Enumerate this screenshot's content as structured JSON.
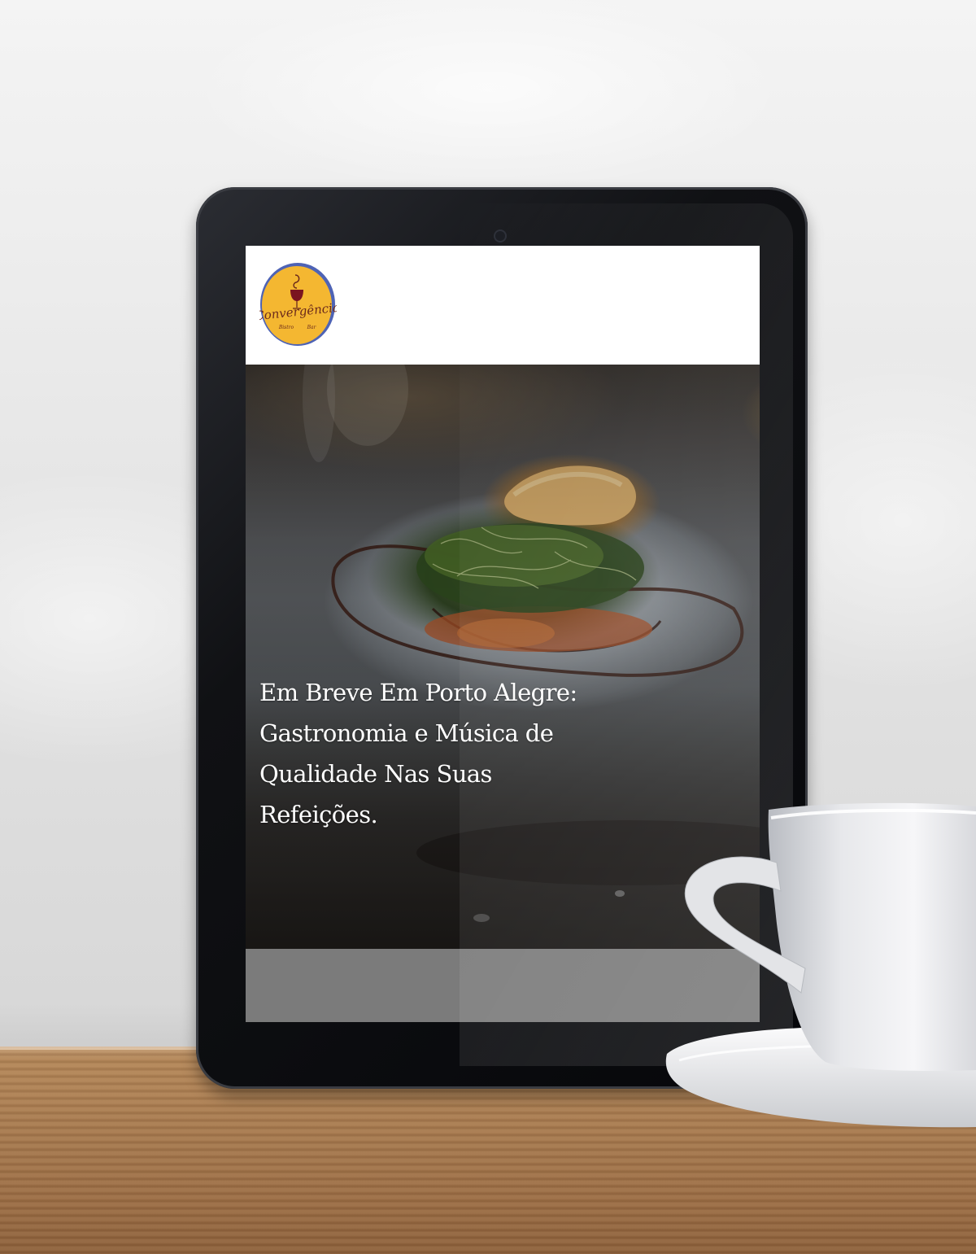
{
  "site": {
    "logo": {
      "brand_text": "Convergência",
      "subtitle_left": "Bistro",
      "subtitle_right": "Bar",
      "colors": {
        "fill": "#f4b731",
        "ring": "#4e63b5",
        "text": "#6b2a1c"
      }
    }
  },
  "hero": {
    "title": "Em Breve Em Porto Alegre: Gastronomia e Música de Qualidade Nas Suas Refeições."
  },
  "colors": {
    "tablet_bezel": "#0b0c0f",
    "header_bg": "#ffffff",
    "footer_band": "#7b7b7b",
    "hero_text": "#ffffff"
  },
  "icons": {
    "camera": "camera-icon",
    "logo": "convergencia-logo"
  }
}
